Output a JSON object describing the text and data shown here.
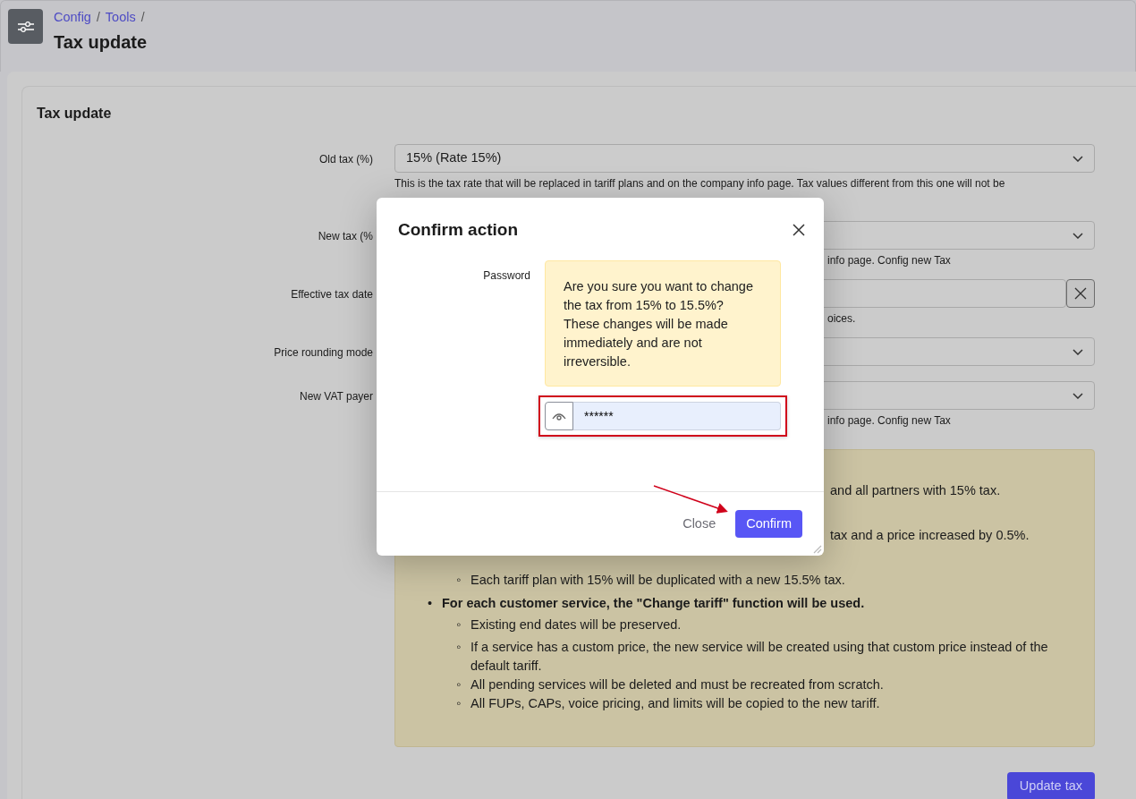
{
  "breadcrumb": [
    {
      "label": "Config",
      "separator": "/"
    },
    {
      "label": "Tools",
      "separator": "/"
    }
  ],
  "page_title": "Tax update",
  "card_title": "Tax update",
  "fields": [
    {
      "kind": "select",
      "label": "Old tax (%)",
      "value": "15% (Rate 15%)",
      "help": "This is the tax rate that will be replaced in tariff plans and on the company info page. Tax values different from this one will not be"
    },
    {
      "kind": "select",
      "label": "New tax (%",
      "help": "info page. Config new Tax"
    },
    {
      "kind": "date",
      "label": "Effective tax date",
      "help": "oices."
    },
    {
      "kind": "select",
      "label": "Price rounding mode"
    },
    {
      "kind": "select",
      "label": "New VAT payer",
      "help": "info page. Config new Tax"
    }
  ],
  "notice": [
    {
      "kind": "fragment",
      "text": "and all partners with 15% tax."
    },
    {
      "kind": "fragment",
      "text": "tax and a price increased by 0.5%."
    },
    {
      "kind": "sub",
      "marker": "◦",
      "text": "Each tariff plan with 15% will be duplicated with a new 15.5% tax."
    },
    {
      "kind": "bullet",
      "marker": "•",
      "text": "For each customer service, the \"Change tariff\" function will be used.",
      "children": [
        {
          "marker": "◦",
          "text": "Existing end dates will be preserved."
        },
        {
          "marker": "◦",
          "text": "If a service has a custom price, the new service will be created using that custom price instead of the default tariff."
        },
        {
          "marker": "◦",
          "text": "All pending services will be deleted and must be recreated from scratch."
        },
        {
          "marker": "◦",
          "text": "All FUPs, CAPs, voice pricing, and limits will be copied to the new tariff."
        }
      ]
    }
  ],
  "submit": "Update tax",
  "modal": {
    "title": "Confirm action",
    "label": "Password",
    "warning": "Are you sure you want to change the tax from 15% to 15.5%? These changes will be made immediately and are not irreversible.",
    "password": "******",
    "buttons": [
      {
        "kind": "secondary",
        "label": "Close"
      },
      {
        "kind": "primary",
        "label": "Confirm"
      }
    ]
  }
}
